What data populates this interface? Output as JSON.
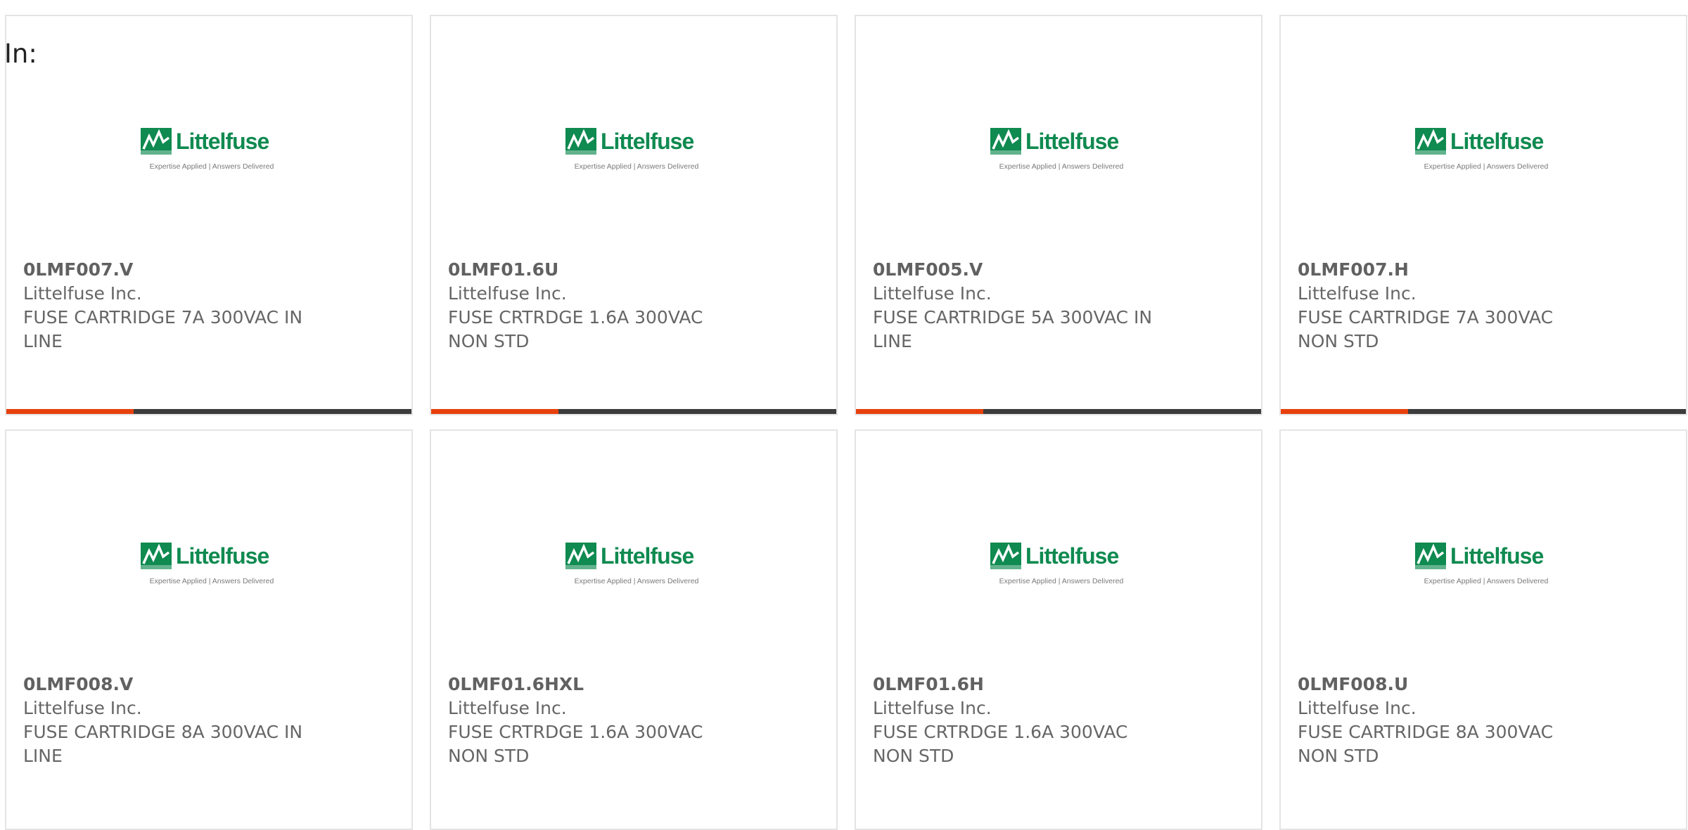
{
  "header": {
    "label": "In:"
  },
  "colors": {
    "brand_green": "#0f8a50",
    "accent_orange": "#e8400c",
    "bar_dark": "#3c3c3c",
    "text_gray": "#666666"
  },
  "logo": {
    "icon": "littelfuse-logo-icon",
    "wordmark": "Littelfuse",
    "tagline": "Expertise Applied | Answers Delivered"
  },
  "products": [
    {
      "part_number": "0LMF007.V",
      "manufacturer": "Littelfuse Inc.",
      "description_line1": "FUSE CARTRIDGE 7A 300VAC IN",
      "description_line2": "LINE",
      "bar_fill_fraction": 0.315
    },
    {
      "part_number": "0LMF01.6U",
      "manufacturer": "Littelfuse Inc.",
      "description_line1": "FUSE CRTRDGE 1.6A 300VAC",
      "description_line2": "NON STD",
      "bar_fill_fraction": 0.315
    },
    {
      "part_number": "0LMF005.V",
      "manufacturer": "Littelfuse Inc.",
      "description_line1": "FUSE CARTRIDGE 5A 300VAC IN",
      "description_line2": "LINE",
      "bar_fill_fraction": 0.315
    },
    {
      "part_number": "0LMF007.H",
      "manufacturer": "Littelfuse Inc.",
      "description_line1": "FUSE CARTRIDGE 7A 300VAC",
      "description_line2": "NON STD",
      "bar_fill_fraction": 0.315
    },
    {
      "part_number": "0LMF008.V",
      "manufacturer": "Littelfuse Inc.",
      "description_line1": "FUSE CARTRIDGE 8A 300VAC IN",
      "description_line2": "LINE",
      "bar_fill_fraction": null
    },
    {
      "part_number": "0LMF01.6HXL",
      "manufacturer": "Littelfuse Inc.",
      "description_line1": "FUSE CRTRDGE 1.6A 300VAC",
      "description_line2": "NON STD",
      "bar_fill_fraction": null
    },
    {
      "part_number": "0LMF01.6H",
      "manufacturer": "Littelfuse Inc.",
      "description_line1": "FUSE CRTRDGE 1.6A 300VAC",
      "description_line2": "NON STD",
      "bar_fill_fraction": null
    },
    {
      "part_number": "0LMF008.U",
      "manufacturer": "Littelfuse Inc.",
      "description_line1": "FUSE CARTRIDGE 8A 300VAC",
      "description_line2": "NON STD",
      "bar_fill_fraction": null
    }
  ]
}
